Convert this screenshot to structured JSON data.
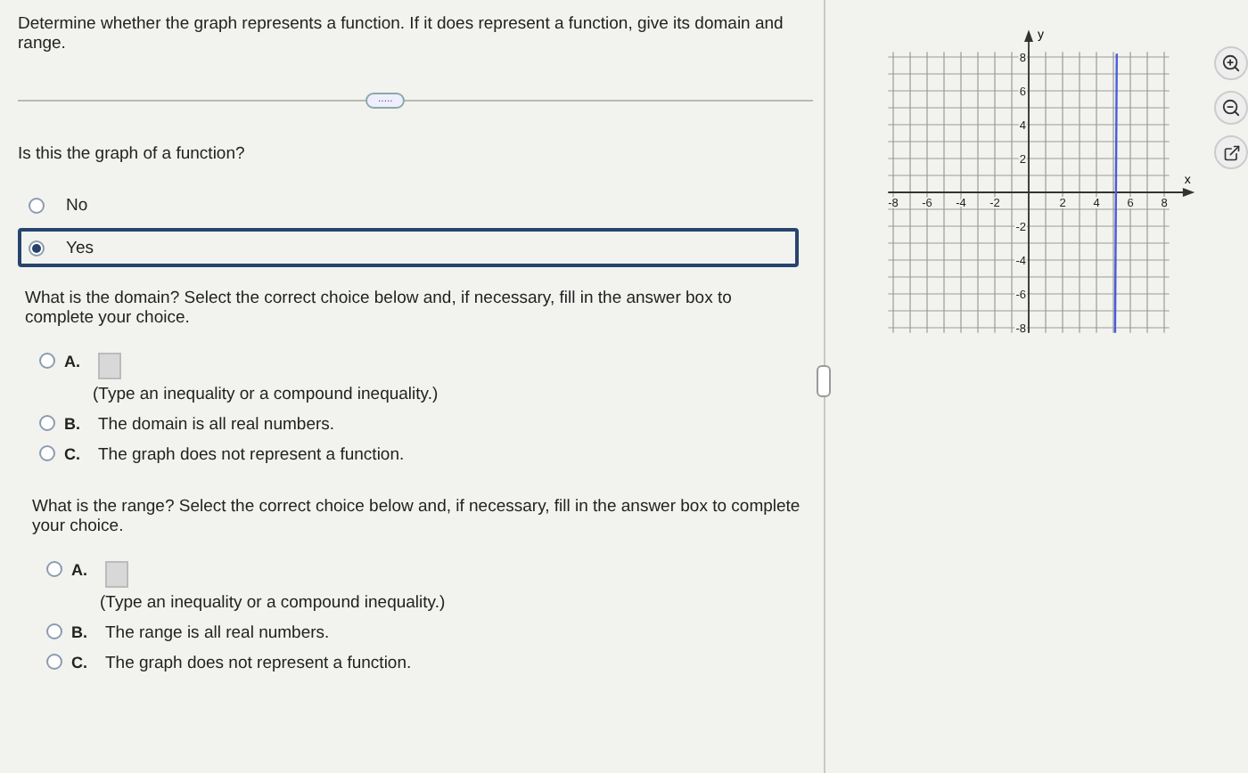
{
  "instructions": "Determine whether the graph represents a function. If it does represent a function, give its domain and range.",
  "expand_label": ".....",
  "function_question": {
    "prompt": "Is this the graph of a function?",
    "options": [
      {
        "label": "No",
        "selected": false
      },
      {
        "label": "Yes",
        "selected": true
      }
    ]
  },
  "parts": [
    {
      "prompt": "What is the domain? Select the correct choice below and, if necessary, fill in the answer box to complete your choice.",
      "choices": [
        {
          "letter": "A.",
          "kind": "answer_box",
          "note": "(Type an inequality or a compound inequality.)",
          "selected": false
        },
        {
          "letter": "B.",
          "kind": "text",
          "text": "The domain is all real numbers.",
          "selected": false
        },
        {
          "letter": "C.",
          "kind": "text",
          "text": "The graph does not represent a function.",
          "selected": false
        }
      ]
    },
    {
      "prompt": "What is the range? Select the correct choice below and, if necessary, fill in the answer box to complete your choice.",
      "choices": [
        {
          "letter": "A.",
          "kind": "answer_box",
          "note": "(Type an inequality or a compound inequality.)",
          "selected": false
        },
        {
          "letter": "B.",
          "kind": "text",
          "text": "The range is all real numbers.",
          "selected": false
        },
        {
          "letter": "C.",
          "kind": "text",
          "text": "The graph does not represent a function.",
          "selected": false
        }
      ]
    }
  ],
  "graph": {
    "x_axis_label": "x",
    "y_axis_label": "y",
    "x_ticks": [
      "-8",
      "-6",
      "-4",
      "-2",
      "2",
      "4",
      "6",
      "8"
    ],
    "y_ticks": [
      "8",
      "6",
      "4",
      "2",
      "-2",
      "-4",
      "-6",
      "-8"
    ]
  }
}
